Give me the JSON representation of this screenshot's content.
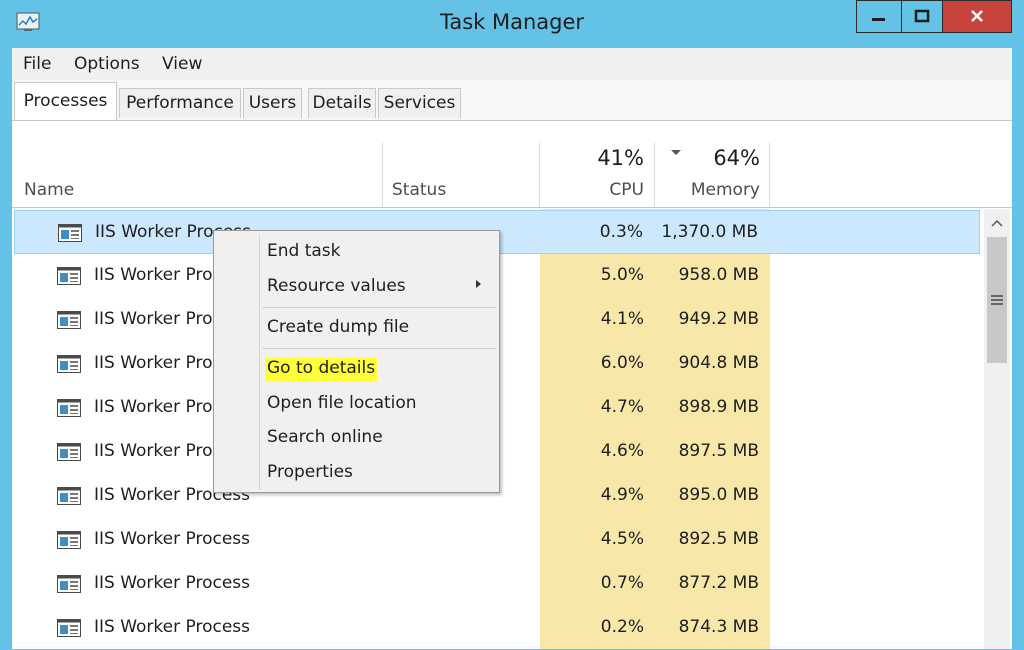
{
  "window": {
    "title": "Task Manager"
  },
  "menu": [
    "File",
    "Options",
    "View"
  ],
  "tabs": [
    "Processes",
    "Performance",
    "Users",
    "Details",
    "Services"
  ],
  "active_tab": "Processes",
  "columns": {
    "name": "Name",
    "status": "Status",
    "cpu_label": "CPU",
    "cpu_total": "41%",
    "memory_label": "Memory",
    "memory_total": "64%"
  },
  "processes": [
    {
      "name": "IIS Worker Process",
      "cpu": "0.3%",
      "memory": "1,370.0 MB",
      "selected": true
    },
    {
      "name": "IIS Worker Process",
      "cpu": "5.0%",
      "memory": "958.0 MB"
    },
    {
      "name": "IIS Worker Process",
      "cpu": "4.1%",
      "memory": "949.2 MB"
    },
    {
      "name": "IIS Worker Process",
      "cpu": "6.0%",
      "memory": "904.8 MB"
    },
    {
      "name": "IIS Worker Process",
      "cpu": "4.7%",
      "memory": "898.9 MB"
    },
    {
      "name": "IIS Worker Process",
      "cpu": "4.6%",
      "memory": "897.5 MB"
    },
    {
      "name": "IIS Worker Process",
      "cpu": "4.9%",
      "memory": "895.0 MB"
    },
    {
      "name": "IIS Worker Process",
      "cpu": "4.5%",
      "memory": "892.5 MB"
    },
    {
      "name": "IIS Worker Process",
      "cpu": "0.7%",
      "memory": "877.2 MB"
    },
    {
      "name": "IIS Worker Process",
      "cpu": "0.2%",
      "memory": "874.3 MB"
    }
  ],
  "context_menu": {
    "end_task": "End task",
    "resource_values": "Resource values",
    "create_dump_file": "Create dump file",
    "go_to_details": "Go to details",
    "open_file_location": "Open file location",
    "search_online": "Search online",
    "properties": "Properties"
  },
  "colors": {
    "titlebar": "#63c2e6",
    "close_button": "#c6443b",
    "highlight_yellow": "#ffff3a",
    "resource_column": "#f7e7a8",
    "selection": "#cce8ff"
  },
  "icons": {
    "app": "task-manager-icon",
    "process": "process-window-icon",
    "minimize": "minimize-icon",
    "maximize": "maximize-icon",
    "close": "close-icon"
  }
}
